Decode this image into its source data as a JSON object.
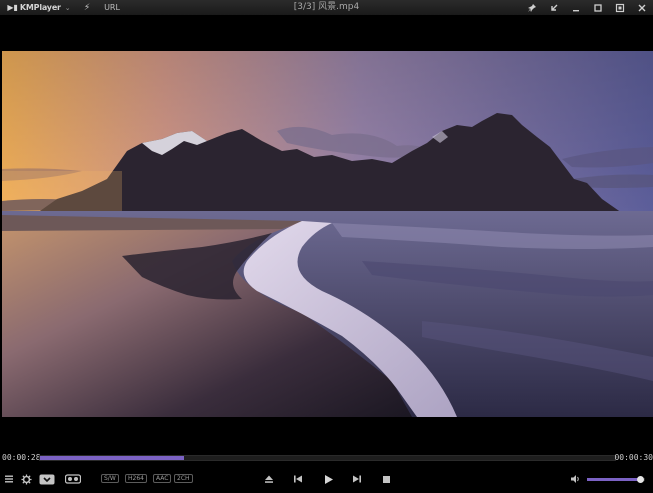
{
  "app": {
    "logo_text": "KMPlayer",
    "url_label": "URL",
    "window_title": "[3/3] 风景.mp4"
  },
  "titlebar_icons": [
    "lightning-icon",
    "pin-icon",
    "mini-mode-icon",
    "minimize-icon",
    "maximize-icon",
    "fullscreen-icon",
    "close-icon"
  ],
  "playback": {
    "current_time": "00:00:28",
    "total_time": "00:00:30",
    "progress_fraction": 0.25,
    "volume_fraction": 0.92
  },
  "badges": [
    "S/W",
    "H264",
    "AAC",
    "2CH"
  ],
  "controls": [
    "menu-icon",
    "settings-icon",
    "capture-icon",
    "vr-glasses-icon",
    "eject-icon",
    "previous-icon",
    "play-icon",
    "next-icon",
    "stop-icon",
    "volume-icon"
  ],
  "colors": {
    "accent": "#7b62c4",
    "titlebar": "#222222",
    "background": "#000000"
  }
}
